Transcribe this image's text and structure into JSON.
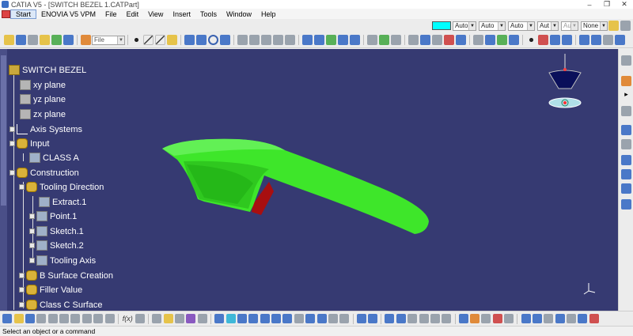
{
  "window": {
    "title": "CATIA V5 - [SWITCH BEZEL 1.CATPart]",
    "minimize": "–",
    "restore": "❐",
    "close": "✕"
  },
  "menu": {
    "items": [
      "Start",
      "ENOVIA V5 VPM",
      "File",
      "Edit",
      "View",
      "Insert",
      "Tools",
      "Window",
      "Help"
    ]
  },
  "toolbar": {
    "file_select": "File",
    "color_swatch": "#00ffff",
    "dropdowns": [
      "Auto",
      "Auto",
      "Auto",
      "Aut",
      "Aut",
      "None"
    ]
  },
  "tree": {
    "root": "SWITCH BEZEL",
    "nodes": [
      {
        "label": "xy plane"
      },
      {
        "label": "yz plane"
      },
      {
        "label": "zx plane"
      },
      {
        "label": "Axis Systems"
      },
      {
        "label": "Input"
      },
      {
        "label": "CLASS A"
      },
      {
        "label": "Construction"
      },
      {
        "label": "Tooling Direction"
      },
      {
        "label": "Extract.1"
      },
      {
        "label": "Point.1"
      },
      {
        "label": "Sketch.1"
      },
      {
        "label": "Sketch.2"
      },
      {
        "label": "Tooling Axis"
      },
      {
        "label": "B Surface Creation"
      },
      {
        "label": "Filler Value"
      },
      {
        "label": "Class C Surface"
      }
    ]
  },
  "colors": {
    "viewport_bg": "#363a72",
    "part_green": "#3ee62a",
    "part_red": "#a80f10",
    "compass_navy": "#0a0f5a"
  },
  "bottom_toolbar": {
    "fog_label": "f(x)"
  },
  "status": {
    "message": "Select an object or a command"
  }
}
